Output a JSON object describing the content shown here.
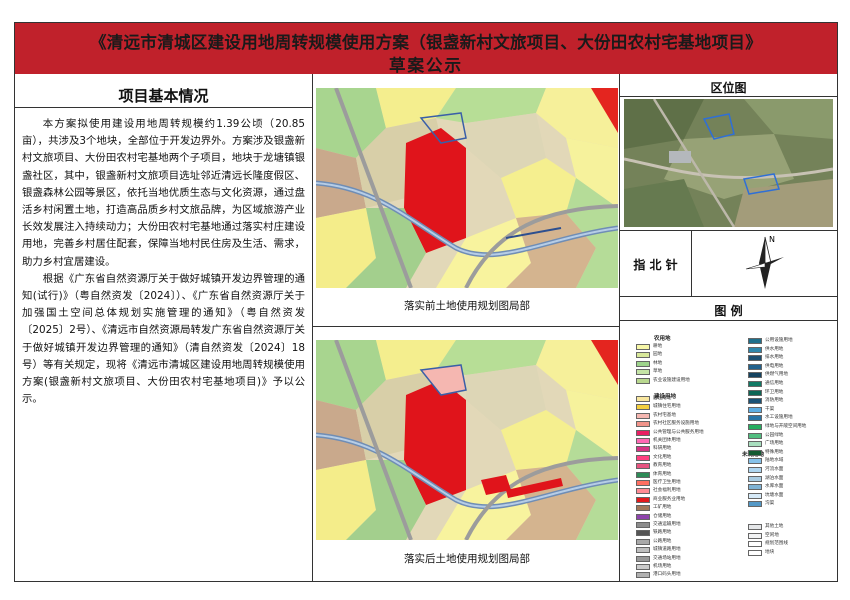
{
  "header": {
    "title_line1": "《清远市清城区建设用地周转规模使用方案（银盏新村文旅项目、大份田农村宅基地项目》",
    "title_line2": "草案公示",
    "bar_color": "#c0212b"
  },
  "left": {
    "heading": "项目基本情况",
    "paragraphs": [
      "本方案拟使用建设用地周转规模约1.39公顷（20.85亩），共涉及3个地块，全部位于开发边界外。方案涉及银盏新村文旅项目、大份田农村宅基地两个子项目，地块于龙塘镇银盏社区，其中，银盏新村文旅项目选址邻近清远长隆度假区、银盏森林公园等景区，依托当地优质生态与文化资源，通过盘活乡村闲置土地，打造高品质乡村文旅品牌，为区域旅游产业长效发展注入持续动力；大份田农村宅基地通过落实村庄建设用地，完善乡村居住配套，保障当地村民住房及生活、需求，助力乡村宜居建设。",
      "根据《广东省自然资源厅关于做好城镇开发边界管理的通知(试行)》（粤自然资发〔2024〕）、《广东省自然资源厅关于加强国土空间总体规划实施管理的通知》（粤自然资发〔2025〕2号）、《清远市自然资源局转发广东省自然资源厅关于做好城镇开发边界管理的通知》（清自然资发〔2024〕18号）等有关规定，现将《清远市清城区建设用地周转规模使用方案(银盏新村文旅项目、大份田农村宅基地项目)》予以公示。"
    ]
  },
  "maps": {
    "before_caption": "落实前土地使用规划图局部",
    "after_caption": "落实后土地使用规划图局部"
  },
  "right": {
    "location_heading": "区位图",
    "north_label": "指 北 针",
    "north_letter": "N",
    "legend_heading": "图  例"
  },
  "legend": {
    "group_agri": "农用地",
    "group_build": "建设用地",
    "group_unused": "未利用地",
    "items_left": [
      {
        "label": "耕地",
        "color": "#f7f7a8"
      },
      {
        "label": "园地",
        "color": "#d8e89a"
      },
      {
        "label": "林地",
        "color": "#9ed48c"
      },
      {
        "label": "草地",
        "color": "#c5e4a6"
      },
      {
        "label": "农业设施建设用地",
        "color": "#b9d88f"
      },
      {
        "label": "居住用地",
        "color": "#f9e79f"
      },
      {
        "label": "城镇住宅用地",
        "color": "#f4d03f"
      },
      {
        "label": "农村宅基地",
        "color": "#f5b7b1"
      },
      {
        "label": "农村社区服务设施用地",
        "color": "#f1948a"
      },
      {
        "label": "公共管理与公共服务用地",
        "color": "#e91e63"
      },
      {
        "label": "机关团体用地",
        "color": "#ff69b4"
      },
      {
        "label": "科研用地",
        "color": "#d63384"
      },
      {
        "label": "文化用地",
        "color": "#ff4081"
      },
      {
        "label": "教育用地",
        "color": "#e75480"
      },
      {
        "label": "体育用地",
        "color": "#2e8b57"
      },
      {
        "label": "医疗卫生用地",
        "color": "#ff6f61"
      },
      {
        "label": "社会福利用地",
        "color": "#ff8c94"
      },
      {
        "label": "商业服务业用地",
        "color": "#e31a1c"
      },
      {
        "label": "工矿用地",
        "color": "#a0785a"
      },
      {
        "label": "仓储用地",
        "color": "#8e44ad"
      },
      {
        "label": "交通运输用地",
        "color": "#8c8c8c"
      },
      {
        "label": "铁路用地",
        "color": "#555555"
      },
      {
        "label": "公路用地",
        "color": "#a9a9a9"
      },
      {
        "label": "城镇道路用地",
        "color": "#bfbfbf"
      },
      {
        "label": "交通场站用地",
        "color": "#999999"
      },
      {
        "label": "机场用地",
        "color": "#cccccc"
      },
      {
        "label": "港口码头用地",
        "color": "#b0b0b0"
      }
    ],
    "items_right": [
      {
        "label": "公用设施用地",
        "color": "#1f6f8b"
      },
      {
        "label": "供水用地",
        "color": "#2e86ab"
      },
      {
        "label": "排水用地",
        "color": "#1b4f72"
      },
      {
        "label": "供电用地",
        "color": "#21618c"
      },
      {
        "label": "供燃气用地",
        "color": "#154360"
      },
      {
        "label": "通信用地",
        "color": "#117a65"
      },
      {
        "label": "环卫用地",
        "color": "#0e6655"
      },
      {
        "label": "消防用地",
        "color": "#1a5276"
      },
      {
        "label": "干渠",
        "color": "#5dade2"
      },
      {
        "label": "水工设施用地",
        "color": "#2874a6"
      },
      {
        "label": "绿地与开敞空间用地",
        "color": "#27ae60"
      },
      {
        "label": "公园绿地",
        "color": "#52be80"
      },
      {
        "label": "广场用地",
        "color": "#a9dfbf"
      },
      {
        "label": "特殊用地",
        "color": "#145a32"
      },
      {
        "label": "陆地水域",
        "color": "#85c1e9"
      },
      {
        "label": "河流水面",
        "color": "#aed6f1"
      },
      {
        "label": "湖泊水面",
        "color": "#a9cce3"
      },
      {
        "label": "水库水面",
        "color": "#7fb3d5"
      },
      {
        "label": "坑塘水面",
        "color": "#d6eaf8"
      },
      {
        "label": "沟渠",
        "color": "#5499c7"
      },
      {
        "label": "其他土地",
        "color": "#e5e7e9"
      },
      {
        "label": "空闲地",
        "color": "#f2f3f4"
      },
      {
        "label": "规划范围线",
        "color": "#ffffff"
      },
      {
        "label": "地块",
        "color": "#ffffff"
      }
    ]
  }
}
